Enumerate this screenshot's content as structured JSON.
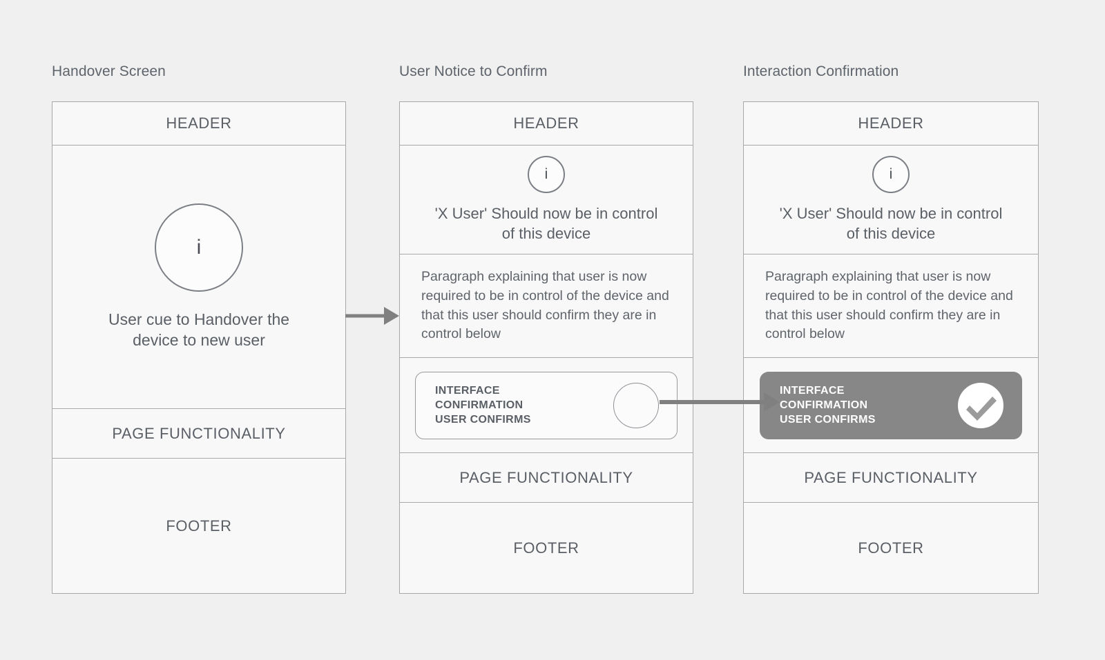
{
  "diagram": {
    "title_column_1": "Handover Screen",
    "title_column_2": "User Notice to Confirm",
    "title_column_3": "Interaction Confirmation",
    "accent_gray": "#878787",
    "border_gray": "#a8a8a8",
    "text_gray": "#5a5f66",
    "background": "#f0f0f0",
    "panel_background": "#f8f8f8"
  },
  "common": {
    "header_label": "HEADER",
    "page_functionality_label": "PAGE FUNCTIONALITY",
    "footer_label": "FOOTER",
    "info_glyph": "i"
  },
  "screen1": {
    "cue_text": "User cue to Handover the device to new user"
  },
  "screen2": {
    "notice_text": "'X User' Should now be in control of this device",
    "paragraph_text": "Paragraph explaining that user is now required to be in control of the device and that this user should confirm they are in control below",
    "confirm_line_1": "INTERFACE",
    "confirm_line_2": "CONFIRMATION",
    "confirm_line_3": "USER CONFIRMS",
    "toggle_state": "unconfirmed"
  },
  "screen3": {
    "notice_text": "'X User' Should now be in control of this device",
    "paragraph_text": "Paragraph explaining that user is now required to be in control of the device and that this user should confirm they are in control below",
    "confirm_line_1": "INTERFACE",
    "confirm_line_2": "CONFIRMATION",
    "confirm_line_3": "USER CONFIRMS",
    "toggle_state": "confirmed"
  },
  "connectors": {
    "arrow_1_from": "Handover Screen",
    "arrow_1_to": "User Notice to Confirm",
    "arrow_2_from": "User Notice to Confirm",
    "arrow_2_to": "Interaction Confirmation"
  }
}
